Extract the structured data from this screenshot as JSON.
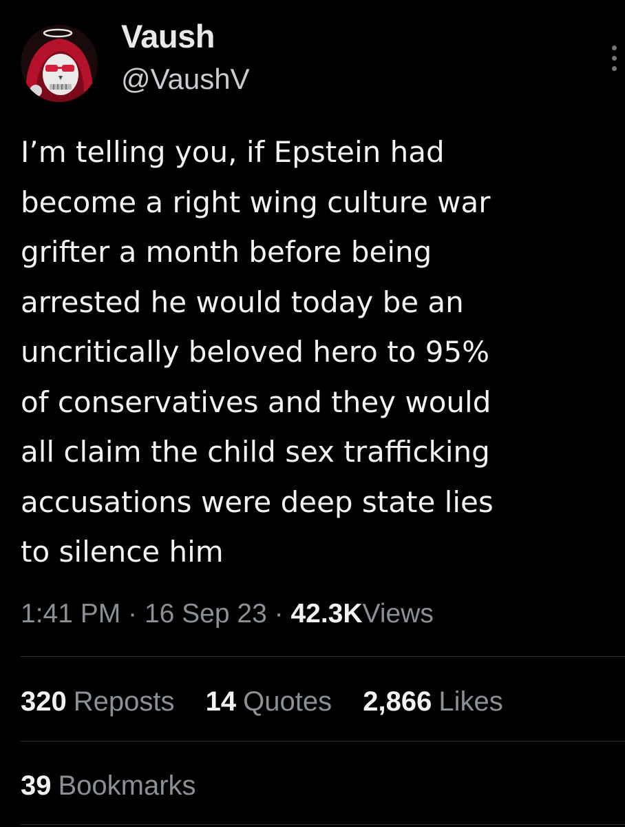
{
  "author": {
    "display_name": "Vaush",
    "handle": "@VaushV",
    "avatar_icon": "red-hooded-skull-avatar"
  },
  "more_options_icon": "vertical-ellipsis-icon",
  "tweet": {
    "text": "I’m telling you, if Epstein had\nbecome a right wing culture war\ngrifter a month before being\narrested he would today be an\nuncritically beloved hero to 95%\nof conservatives and they would\nall claim the child sex trafficking\naccusations were deep state lies\nto silence him"
  },
  "meta": {
    "time": "1:41 PM",
    "separator": "·",
    "date": "16 Sep 23",
    "views_count": "42.3K",
    "views_label": "Views"
  },
  "stats": {
    "reposts_count": "320",
    "reposts_label": "Reposts",
    "quotes_count": "14",
    "quotes_label": "Quotes",
    "likes_count": "2,866",
    "likes_label": "Likes",
    "bookmarks_count": "39",
    "bookmarks_label": "Bookmarks"
  },
  "colors": {
    "background": "#000000",
    "primary_text": "#e7e9ea",
    "secondary_text": "#71767b",
    "divider": "#2f3336",
    "avatar_red": "#c8102e"
  }
}
